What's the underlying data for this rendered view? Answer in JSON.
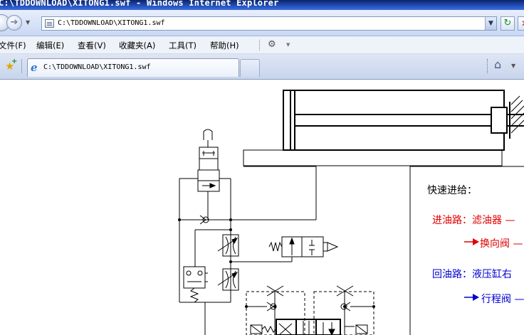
{
  "window": {
    "title": "C:\\TDDOWNLOAD\\XITONG1.swf - Windows Internet Explorer"
  },
  "address_bar": {
    "url": "C:\\TDDOWNLOAD\\XITONG1.swf"
  },
  "menu": {
    "items": [
      "文件(F)",
      "编辑(E)",
      "查看(V)",
      "收藏夹(A)",
      "工具(T)",
      "帮助(H)"
    ]
  },
  "tabs": {
    "active_label": "C:\\TDDOWNLOAD\\XITONG1.swf"
  },
  "content": {
    "heading": "快速进给：",
    "in_path_label": "进油路：滤油器 —",
    "in_path_next": "换向阀 —",
    "return_path_label": "回油路：液压缸右",
    "return_path_next": "行程阀 —"
  },
  "colors": {
    "in_path": "#e00000",
    "return_path": "#0000d0"
  }
}
